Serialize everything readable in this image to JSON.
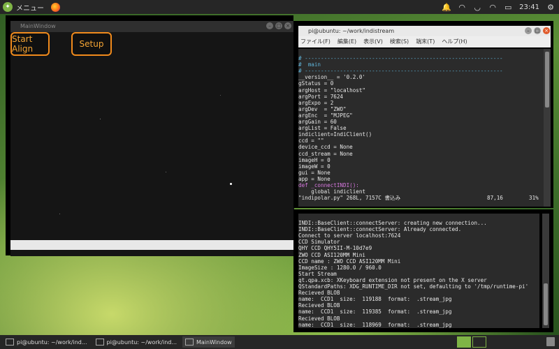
{
  "top_panel": {
    "menu_label": "メニュー",
    "time": "23:41"
  },
  "main_window": {
    "title": "MainWindow",
    "buttons": {
      "start_align": "Start Align",
      "setup": "Setup"
    }
  },
  "terminal_window": {
    "title": "pi@ubuntu: ~/work/indistream",
    "menu": [
      "ファイル(F)",
      "編集(E)",
      "表示(V)",
      "検索(S)",
      "端末(T)",
      "ヘルプ(H)"
    ],
    "status_line": "\"indipolar.py\" 268L, 7157C 書込み",
    "cursor_pos": "87,16",
    "percent": "31%"
  },
  "code_lines": [
    "# --------------------------------------------------------------",
    "#  main",
    "# --------------------------------------------------------------",
    "__version__ = '0.2.0'",
    "gStatus = 0",
    "argHost = \"localhost\"",
    "argPort = 7624",
    "argExpo = 2",
    "argDev  = \"ZWO\"",
    "argEnc  = \"MJPEG\"",
    "argGain = 60",
    "argList = False",
    "indiclient=IndiClient()",
    "ccd = \"\"",
    "device_ccd = None",
    "ccd_stream = None",
    "imageH = 0",
    "imageW = 0",
    "gui = None",
    "app = None",
    "",
    "def _connectINDI():",
    "    global indiclient"
  ],
  "output_lines": [
    "INDI::BaseClient::connectServer: creating new connection...",
    "INDI::BaseClient::connectServer: Already connected.",
    "Connect to server localhost:7624",
    "CCD Simulator",
    "QHY CCD QHY5II-M-10d7e9",
    "ZWO CCD ASI120MM Mini",
    "CCD name : ZWO CCD ASI120MM Mini",
    "ImageSize : 1280.0 / 960.0",
    "Start Stream",
    "qt.qpa.xcb: XKeyboard extension not present on the X server",
    "QStandardPaths: XDG_RUNTIME_DIR not set, defaulting to '/tmp/runtime-pi'",
    "Recieved BLOB",
    "name:  CCD1  size:  119188  format:  .stream_jpg",
    "Recieved BLOB",
    "name:  CCD1  size:  119385  format:  .stream_jpg",
    "Recieved BLOB",
    "name:  CCD1  size:  118969  format:  .stream_jpg"
  ],
  "taskbar": {
    "items": [
      "pi@ubuntu: ~/work/ind...",
      "pi@ubuntu: ~/work/ind...",
      "MainWindow"
    ]
  },
  "colors": {
    "accent_orange": "#f08a1c",
    "mint_green": "#7fb446"
  }
}
